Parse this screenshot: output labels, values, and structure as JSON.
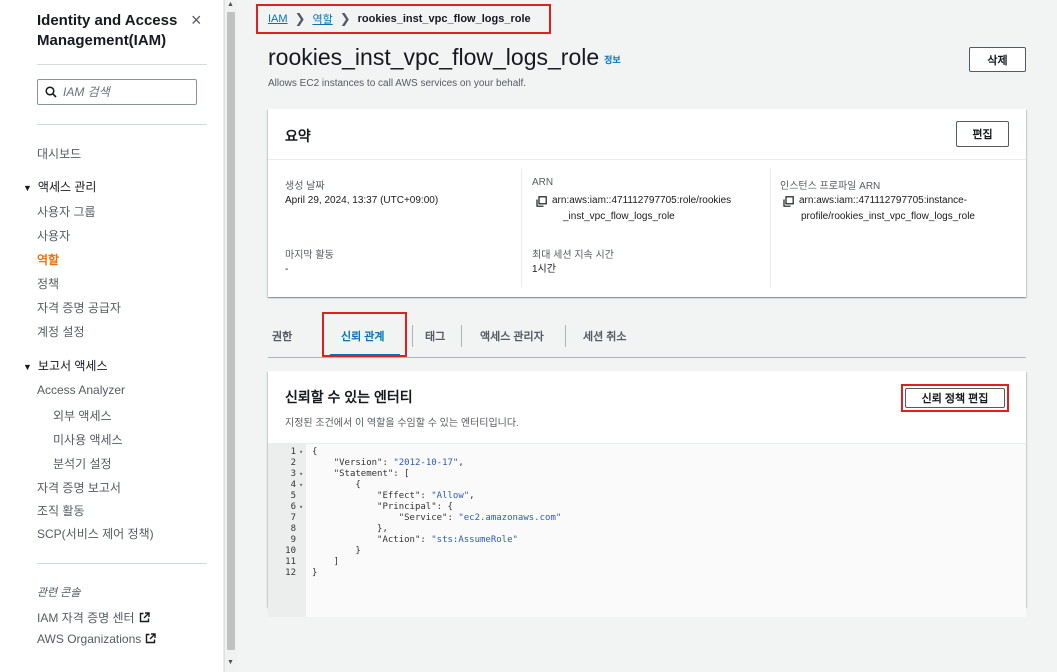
{
  "sidebar": {
    "title": "Identity and Access Management(IAM)",
    "close_symbol": "×",
    "search_placeholder": "IAM 검색",
    "dashboard": "대시보드",
    "access_mgmt": {
      "label": "액세스 관리",
      "items": [
        "사용자 그룹",
        "사용자",
        "역할",
        "정책",
        "자격 증명 공급자",
        "계정 설정"
      ],
      "active_index": 2
    },
    "report_access": {
      "label": "보고서 액세스",
      "analyzer": "Access Analyzer",
      "sub_items": [
        "외부 액세스",
        "미사용 액세스",
        "분석기 설정"
      ],
      "items": [
        "자격 증명 보고서",
        "조직 활동",
        "SCP(서비스 제어 정책)"
      ]
    },
    "related": {
      "label": "관련 콘솔",
      "items": [
        "IAM 자격 증명 센터",
        "AWS Organizations"
      ]
    },
    "icons": {
      "search": "search-icon",
      "close": "close-icon",
      "external": "external-link-icon",
      "caret": "caret-down-icon"
    }
  },
  "breadcrumb": {
    "items": [
      "IAM",
      "역할",
      "rookies_inst_vpc_flow_logs_role"
    ],
    "separator": "❯"
  },
  "page": {
    "title": "rookies_inst_vpc_flow_logs_role",
    "info": "정보",
    "description": "Allows EC2 instances to call AWS services on your behalf.",
    "delete_button": "삭제"
  },
  "summary": {
    "heading": "요약",
    "edit_button": "편집",
    "created_label": "생성 날짜",
    "created_value": "April 29, 2024, 13:37 (UTC+09:00)",
    "arn_label": "ARN",
    "arn_line1": "arn:aws:iam::471112797705:role/rookies",
    "arn_line2": "_inst_vpc_flow_logs_role",
    "instance_profile_label": "인스턴스 프로파일 ARN",
    "instance_profile_line1": "arn:aws:iam::471112797705:instance-",
    "instance_profile_line2": "profile/rookies_inst_vpc_flow_logs_role",
    "last_activity_label": "마지막 활동",
    "last_activity_value": "-",
    "max_session_label": "최대 세션 지속 시간",
    "max_session_value": "1시간"
  },
  "tabs": {
    "items": [
      "권한",
      "신뢰 관계",
      "태그",
      "액세스 관리자",
      "세션 취소"
    ],
    "active_index": 1
  },
  "trusted": {
    "heading": "신뢰할 수 있는 엔터티",
    "description": "지정된 조건에서 이 역할을 수임할 수 있는 엔터티입니다.",
    "edit_button": "신뢰 정책 편집",
    "code_lines": [
      {
        "n": "1",
        "fold": true,
        "text": "{"
      },
      {
        "n": "2",
        "fold": false,
        "text": "    \"Version\": \"2012-10-17\","
      },
      {
        "n": "3",
        "fold": true,
        "text": "    \"Statement\": ["
      },
      {
        "n": "4",
        "fold": true,
        "text": "        {"
      },
      {
        "n": "5",
        "fold": false,
        "text": "            \"Effect\": \"Allow\","
      },
      {
        "n": "6",
        "fold": true,
        "text": "            \"Principal\": {"
      },
      {
        "n": "7",
        "fold": false,
        "text": "                \"Service\": \"ec2.amazonaws.com\""
      },
      {
        "n": "8",
        "fold": false,
        "text": "            },"
      },
      {
        "n": "9",
        "fold": false,
        "text": "            \"Action\": \"sts:AssumeRole\""
      },
      {
        "n": "10",
        "fold": false,
        "text": "        }"
      },
      {
        "n": "11",
        "fold": false,
        "text": "    ]"
      },
      {
        "n": "12",
        "fold": false,
        "text": "}"
      }
    ]
  },
  "colors": {
    "link": "#0073bb",
    "active_nav": "#ec7211",
    "highlight": "#e02020"
  }
}
